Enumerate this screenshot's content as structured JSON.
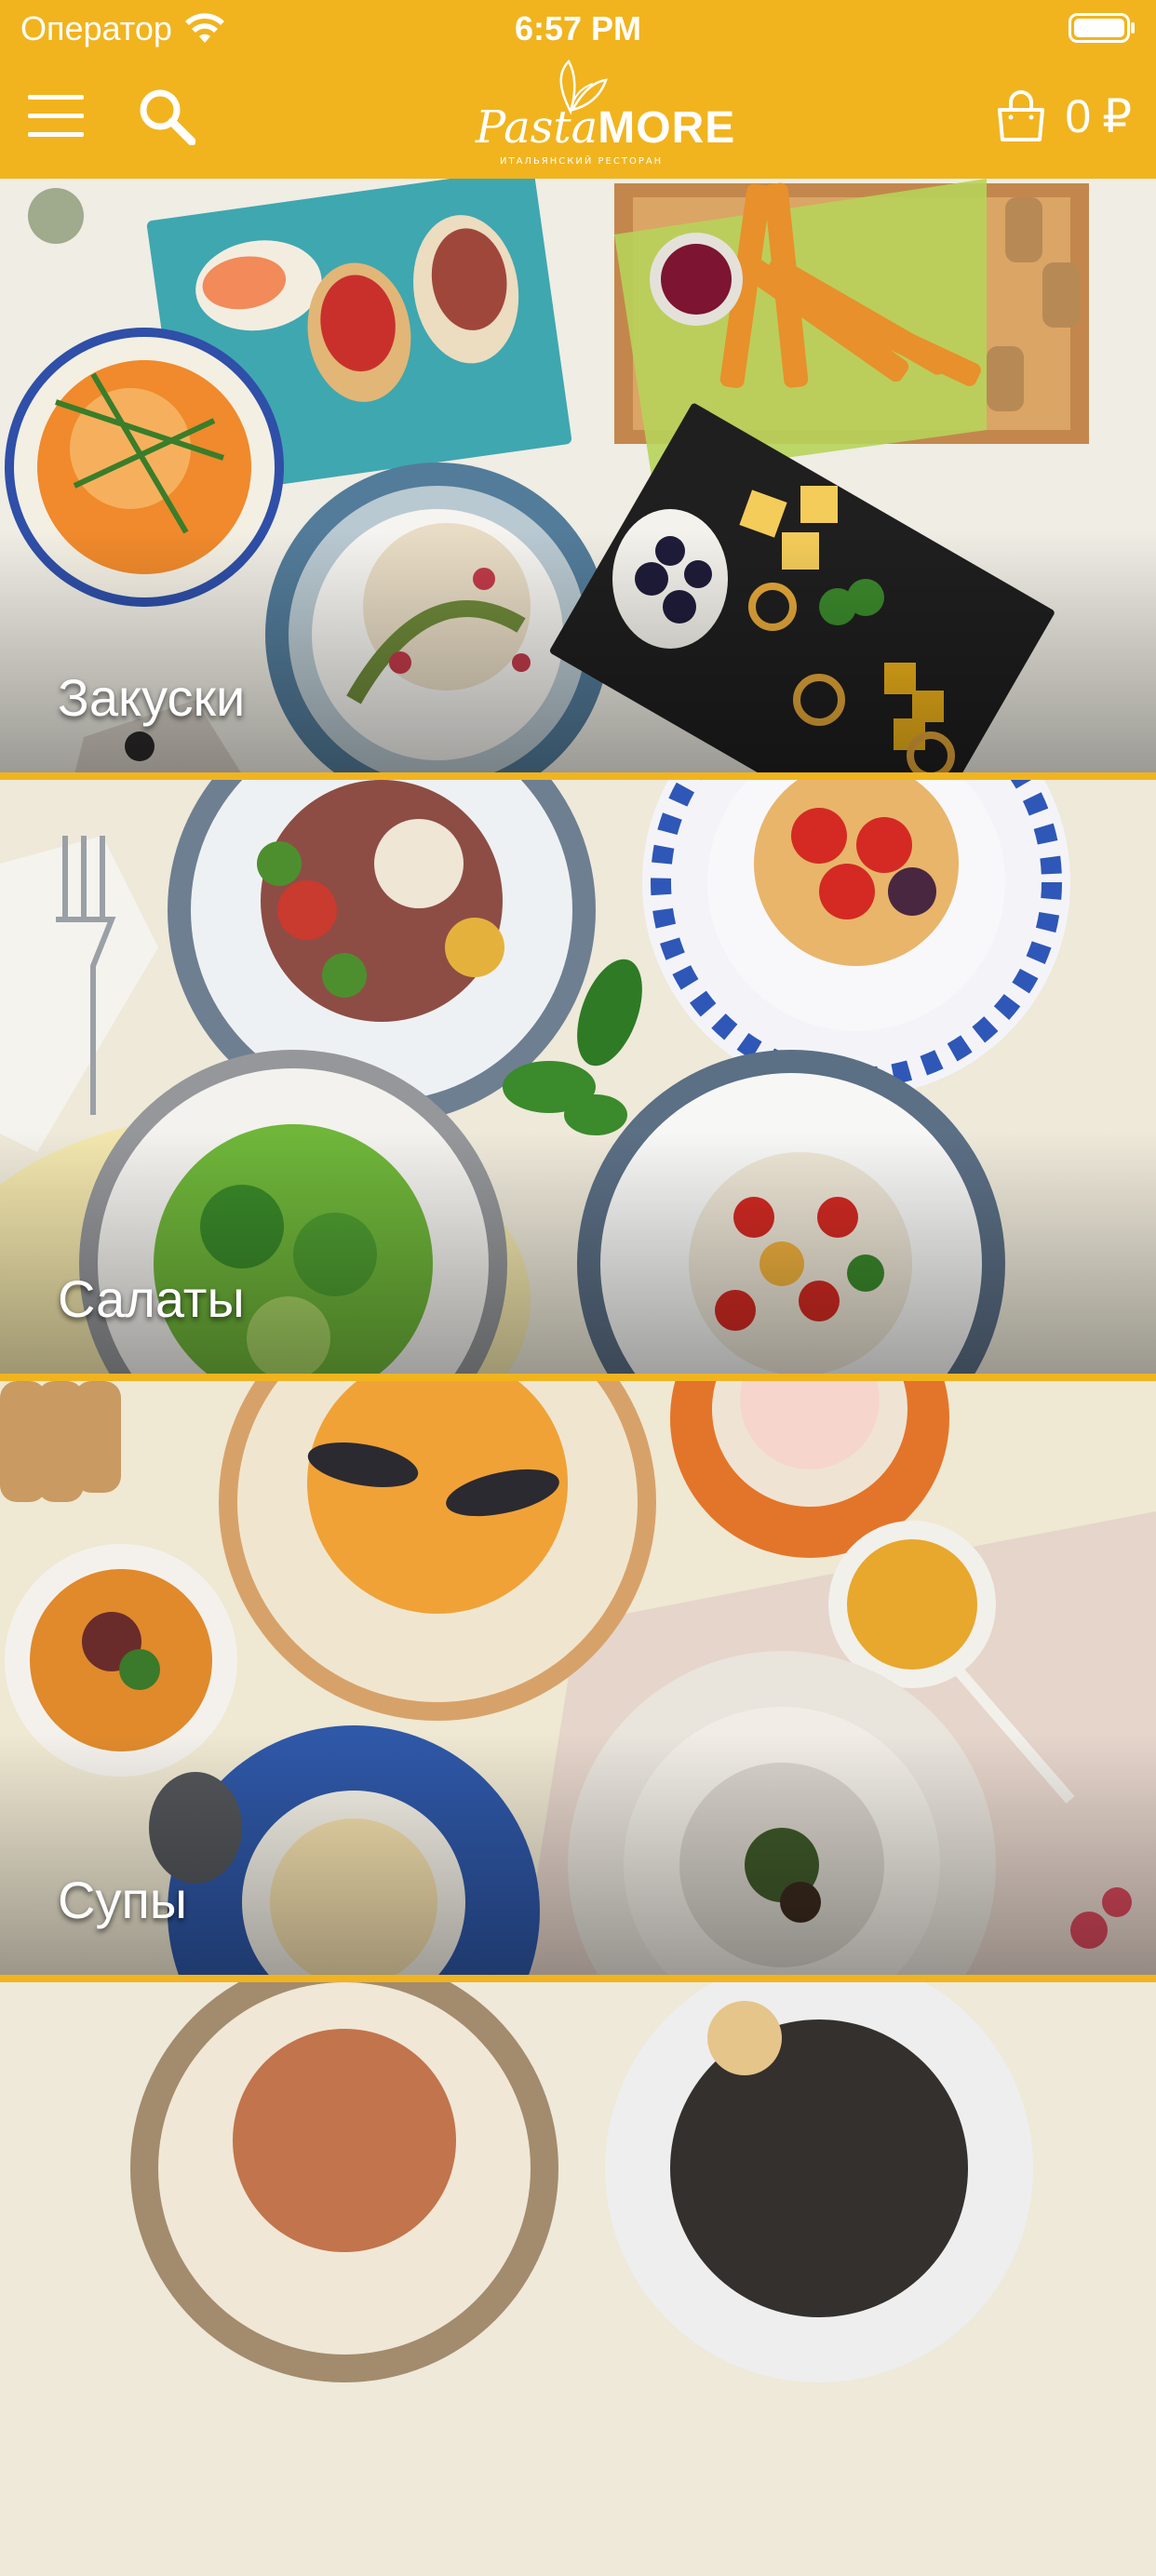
{
  "status_bar": {
    "carrier": "Оператор",
    "time": "6:57 PM"
  },
  "header": {
    "logo_main_pasta": "Pasta",
    "logo_main_more": "MORE",
    "logo_sub": "ИТАЛЬЯНСКИЙ РЕСТОРАН",
    "cart_total": "0",
    "currency": "₽"
  },
  "categories": [
    {
      "title": "Закуски"
    },
    {
      "title": "Салаты"
    },
    {
      "title": "Супы"
    },
    {
      "title": ""
    }
  ],
  "colors": {
    "accent": "#f1b41f",
    "text_on_accent": "#ffffff"
  },
  "icons": [
    "wifi-icon",
    "battery-icon",
    "menu-icon",
    "search-icon",
    "cart-icon"
  ]
}
